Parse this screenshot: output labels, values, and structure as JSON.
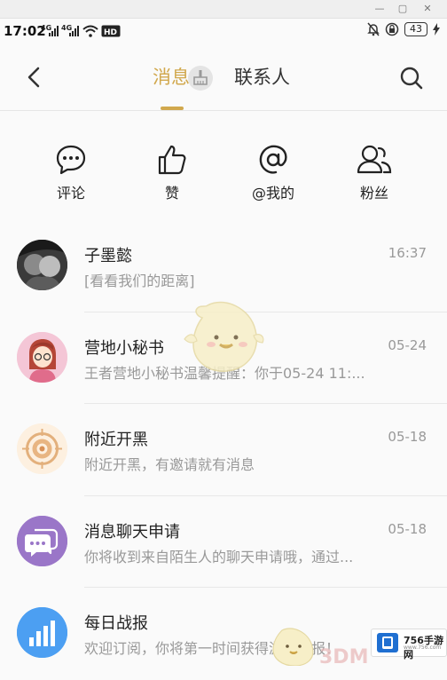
{
  "status_bar": {
    "time": "17:02",
    "net1": "4G",
    "net2": "4G",
    "battery": "43"
  },
  "header": {
    "tab_messages": "消息",
    "tab_contacts": "联系人"
  },
  "quick_actions": [
    {
      "label": "评论",
      "icon": "comment-icon"
    },
    {
      "label": "赞",
      "icon": "thumbs-up-icon"
    },
    {
      "label": "@我的",
      "icon": "at-icon"
    },
    {
      "label": "粉丝",
      "icon": "fans-icon"
    }
  ],
  "conversations": [
    {
      "name": "子墨懿",
      "preview": "[看看我们的距离]",
      "time": "16:37"
    },
    {
      "name": "营地小秘书",
      "preview": "王者营地小秘书温馨提醒：你于05-24 11:...",
      "time": "05-24"
    },
    {
      "name": "附近开黑",
      "preview": "附近开黑，有邀请就有消息",
      "time": "05-18"
    },
    {
      "name": "消息聊天申请",
      "preview": "你将收到来自陌生人的聊天申请哦，通过...",
      "time": "05-18"
    },
    {
      "name": "每日战报",
      "preview": "欢迎订阅，你将第一时间获得游戏战报！",
      "time": ""
    }
  ],
  "watermark": {
    "brand": "756手游网",
    "brand_sub": "www.756.com",
    "text_3dm": "3DM"
  },
  "colors": {
    "accent": "#d1a84d",
    "background": "#fafafa",
    "muted_text": "#999999"
  }
}
